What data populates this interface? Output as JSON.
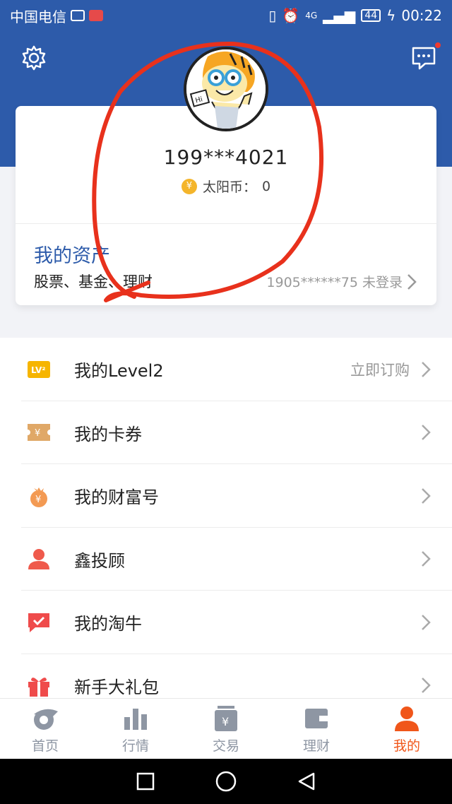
{
  "status_bar": {
    "carrier": "中国电信",
    "network": "4G",
    "battery": "44",
    "time": "00:22"
  },
  "header": {
    "settings_icon": "gear-icon",
    "messages_icon": "chat-bubble-icon",
    "has_unread": true
  },
  "profile": {
    "phone": "199***4021",
    "coin_label": "太阳币：",
    "coin_value": "0",
    "coin_symbol": "¥"
  },
  "assets": {
    "title": "我的资产",
    "subtitle": "股票、基金、理财",
    "account_status": "1905******75 未登录"
  },
  "menu": [
    {
      "label": "我的Level2",
      "icon": "level2-icon",
      "right_text": "立即订购"
    },
    {
      "label": "我的卡券",
      "icon": "coupon-icon",
      "right_text": ""
    },
    {
      "label": "我的财富号",
      "icon": "wealth-icon",
      "right_text": ""
    },
    {
      "label": "鑫投顾",
      "icon": "advisor-icon",
      "right_text": ""
    },
    {
      "label": "我的淘牛",
      "icon": "taoniu-icon",
      "right_text": ""
    },
    {
      "label": "新手大礼包",
      "icon": "gift-icon",
      "right_text": ""
    }
  ],
  "tabs": [
    {
      "label": "首页",
      "icon": "home-icon",
      "active": false
    },
    {
      "label": "行情",
      "icon": "market-icon",
      "active": false
    },
    {
      "label": "交易",
      "icon": "trade-icon",
      "active": false
    },
    {
      "label": "理财",
      "icon": "wallet-icon",
      "active": false
    },
    {
      "label": "我的",
      "icon": "profile-icon",
      "active": true
    }
  ],
  "colors": {
    "brand_blue": "#2d5baa",
    "accent_orange": "#f0561a",
    "annotation_red": "#e8311c"
  }
}
